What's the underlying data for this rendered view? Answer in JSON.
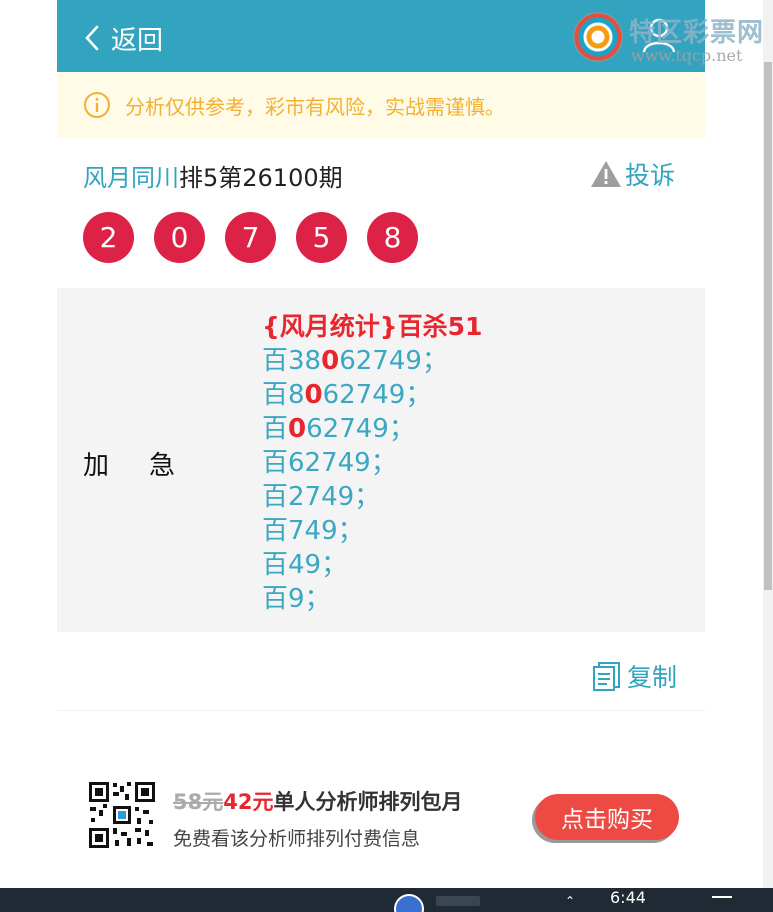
{
  "header": {
    "back_label": "返回",
    "watermark_title": "特区彩票网",
    "watermark_url": "www.tqcp.net"
  },
  "notice": {
    "text": "分析仅供参考，彩市有风险，实战需谨慎。"
  },
  "article": {
    "author": "风月同川",
    "subject": "排5第26100期",
    "report_label": "投诉",
    "balls": [
      "2",
      "0",
      "7",
      "5",
      "8"
    ]
  },
  "content": {
    "tag_chars": [
      "加",
      "急"
    ],
    "headline": "{风月统计}百杀51",
    "lines": [
      {
        "pre": "百38",
        "hl": "0",
        "post": "62749；"
      },
      {
        "pre": "百8",
        "hl": "0",
        "post": "62749；"
      },
      {
        "pre": "百",
        "hl": "0",
        "post": "62749；"
      },
      {
        "pre": "百62749；",
        "hl": "",
        "post": ""
      },
      {
        "pre": "百2749；",
        "hl": "",
        "post": ""
      },
      {
        "pre": "百749；",
        "hl": "",
        "post": ""
      },
      {
        "pre": "百49；",
        "hl": "",
        "post": ""
      },
      {
        "pre": "百9；",
        "hl": "",
        "post": ""
      }
    ],
    "copy_label": "复制"
  },
  "promo": {
    "old_price": "58元",
    "new_price": "42元",
    "title": "单人分析师排列包月",
    "subtitle": "免费看该分析师排列付费信息",
    "buy_label": "点击购买"
  },
  "taskbar": {
    "time": "6:44"
  },
  "colors": {
    "brand": "#33a4c0",
    "ball": "#dc2246",
    "highlight": "#e8262f",
    "notice_bg": "#fffbe6",
    "notice_text": "#f2b134"
  }
}
